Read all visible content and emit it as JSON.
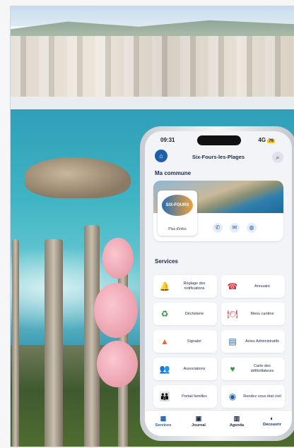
{
  "status": {
    "time": "09:31",
    "network": "4G",
    "battery": "76"
  },
  "app": {
    "title": "Six-Fours-les-Plages"
  },
  "commune": {
    "heading": "Ma commune",
    "crest_text": "SIX-FOURS",
    "more_info": "Plus d'infos"
  },
  "services": {
    "heading": "Services",
    "items": [
      {
        "label": "Réglage des notifications",
        "icon": "bell-icon"
      },
      {
        "label": "Annuaire",
        "icon": "phone-icon"
      },
      {
        "label": "Déchèterie",
        "icon": "recycle-icon"
      },
      {
        "label": "Menu cantine",
        "icon": "plate-icon"
      },
      {
        "label": "Signaler",
        "icon": "cone-icon"
      },
      {
        "label": "Actes Administratifs",
        "icon": "document-icon"
      },
      {
        "label": "Associations",
        "icon": "people-icon"
      },
      {
        "label": "Carte des défibrillateurs",
        "icon": "defibrillator-icon"
      },
      {
        "label": "Portail familles",
        "icon": "family-icon"
      },
      {
        "label": "Rendez vous état civil",
        "icon": "passport-icon"
      }
    ]
  },
  "tabs": [
    {
      "label": "Services",
      "icon": "grid-icon",
      "active": true
    },
    {
      "label": "Journal",
      "icon": "newspaper-icon"
    },
    {
      "label": "Agenda",
      "icon": "calendar-icon"
    },
    {
      "label": "Découvrir",
      "icon": "compass-icon"
    }
  ],
  "colors": {
    "accent": "#1f5fa8",
    "title": "#1a2b4a",
    "battery": "#f2c230"
  }
}
